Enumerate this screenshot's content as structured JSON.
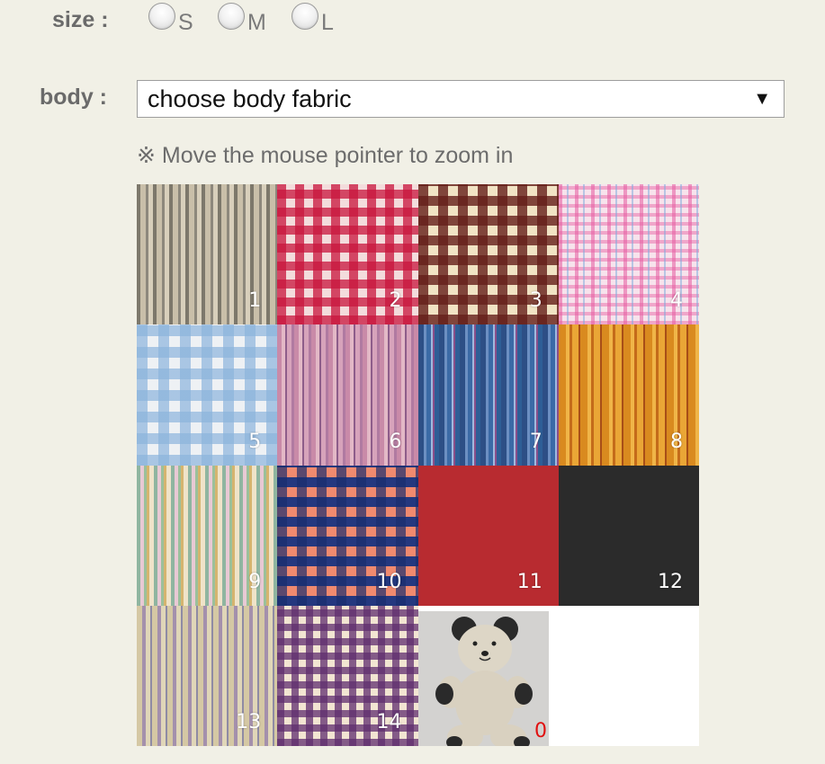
{
  "size": {
    "label": "size :",
    "options": [
      "S",
      "M",
      "L"
    ]
  },
  "body": {
    "label": "body :",
    "selected": "choose body fabric",
    "arrow": "▼"
  },
  "hint": "※ Move the mouse pointer to zoom in",
  "fabrics": [
    "1",
    "2",
    "3",
    "4",
    "5",
    "6",
    "7",
    "8",
    "9",
    "10",
    "11",
    "12",
    "13",
    "14"
  ],
  "preview": {
    "number": "0"
  }
}
